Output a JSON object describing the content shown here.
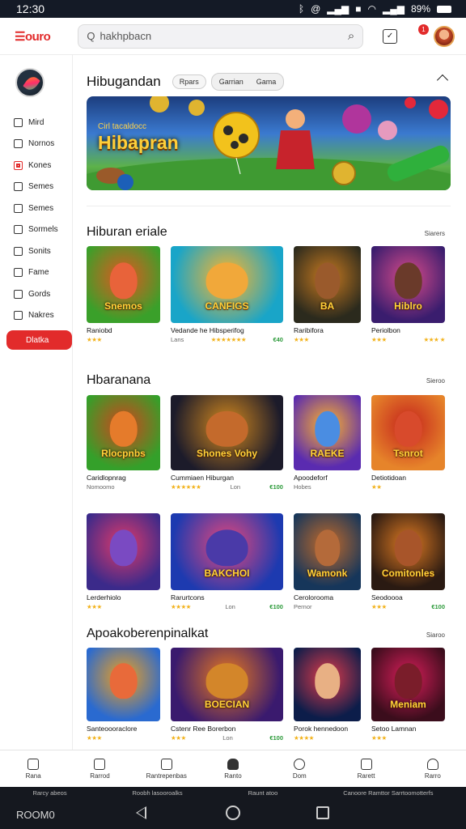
{
  "status": {
    "time": "12:30",
    "battery": "89%"
  },
  "topbar": {
    "logo": "☰ouro",
    "search_placeholder": "hakhpbacn",
    "badge": "1"
  },
  "sidebar": {
    "items": [
      {
        "label": "Mird"
      },
      {
        "label": "Nornos"
      },
      {
        "label": "Kones"
      },
      {
        "label": "Semes"
      },
      {
        "label": "Semes"
      },
      {
        "label": "Sormels"
      },
      {
        "label": "Sonits"
      },
      {
        "label": "Fame"
      },
      {
        "label": "Gords"
      },
      {
        "label": "Nakres"
      }
    ],
    "cta": "Dlatka"
  },
  "hero": {
    "title": "Hibugandan",
    "pills": [
      "Rpars",
      "Garrian",
      "Gama"
    ],
    "caption": "Cirl tacaldocc",
    "banner_text": "Hibapran"
  },
  "sections": [
    {
      "title": "Hiburan eriale",
      "more": "Siarers",
      "cards": [
        {
          "name": "Raniobd",
          "stars": "★★★",
          "meta": "",
          "price": "",
          "label": "Snemos",
          "c1": "#3aa02a",
          "c2": "#e2571f",
          "face": "#e8633a"
        },
        {
          "name": "Vedande he Hibsperifog",
          "stars": "★★★★★★★",
          "meta": "Lans",
          "price": "€40",
          "label": "CANFIGS",
          "c1": "#19a5c8",
          "c2": "#ffb52a",
          "face": "#f1a83a"
        },
        {
          "name": "Raribifora",
          "stars": "★★★",
          "meta": "",
          "price": "",
          "label": "BA",
          "c1": "#2b2a1d",
          "c2": "#c87a20",
          "face": "#9a5a2c"
        },
        {
          "name": "Periolbon",
          "stars": "★★★",
          "meta": "★★★ ★",
          "price": "",
          "label": "Hiblro",
          "c1": "#3a1d6e",
          "c2": "#d94b8a",
          "face": "#6a3a2a"
        }
      ]
    },
    {
      "title": "Hbaranana",
      "more": "Sieroo",
      "cards": [
        {
          "name": "Caridlopnrag",
          "stars": "Nomoomo",
          "meta": "",
          "price": "",
          "label": "Rlocpnbs",
          "c1": "#34a02a",
          "c2": "#d0441c",
          "face": "#e57b2b"
        },
        {
          "name": "Cummiaen Hiburgan",
          "stars": "★★★★★★",
          "meta": "Lon",
          "price": "€100",
          "label": "Shones Vohy",
          "c1": "#1c1b2a",
          "c2": "#d58a1e",
          "face": "#c46a2c"
        },
        {
          "name": "Apoodeforf",
          "stars": "Hobes",
          "meta": "",
          "price": "",
          "label": "RAEKE",
          "c1": "#5a2bb0",
          "c2": "#ffb42a",
          "face": "#4a8de2"
        },
        {
          "name": "Detiotidoan",
          "stars": "★★",
          "meta": "",
          "price": "",
          "label": "Tsnrot",
          "c1": "#e6842a",
          "c2": "#c4221c",
          "face": "#d84a2c"
        }
      ]
    },
    {
      "title": "",
      "more": "",
      "cards": [
        {
          "name": "Lerderhiolo",
          "stars": "★★★",
          "meta": "",
          "price": "",
          "label": "",
          "c1": "#3b2a8a",
          "c2": "#e03a6a",
          "face": "#7a4ac2"
        },
        {
          "name": "Rarurtcons",
          "stars": "★★★★",
          "meta": "Lon",
          "price": "€100",
          "label": "BAKCHOI",
          "c1": "#1d3ab0",
          "c2": "#e8477a",
          "face": "#4a3aa8"
        },
        {
          "name": "Cerolorooma",
          "stars": "Pernor",
          "meta": "",
          "price": "",
          "label": "Wamonk",
          "c1": "#16365a",
          "c2": "#c26a2a",
          "face": "#b46a3a"
        },
        {
          "name": "Seodoooa",
          "stars": "★★★",
          "meta": "",
          "price": "€100",
          "label": "Comitonles",
          "c1": "#2a1a12",
          "c2": "#e07b22",
          "face": "#a8552a"
        }
      ]
    },
    {
      "title": "Apoakoberenpinalkat",
      "more": "Siaroo",
      "cards": [
        {
          "name": "Santeoooraclore",
          "stars": "★★★",
          "meta": "",
          "price": "",
          "label": "",
          "c1": "#2a6ad0",
          "c2": "#f0a01c",
          "face": "#e86a3a"
        },
        {
          "name": "Cstenr Ree Borerbon",
          "stars": "★★★",
          "meta": "Lon",
          "price": "€100",
          "label": "BOECIAN",
          "c1": "#3a1a6e",
          "c2": "#ea7a1e",
          "face": "#d3862a"
        },
        {
          "name": "Porok hennedoon",
          "stars": "★★★★",
          "meta": "",
          "price": "",
          "label": "",
          "c1": "#0c1d4a",
          "c2": "#e03a4a",
          "face": "#e8b084"
        },
        {
          "name": "Setoo Lamnan",
          "stars": "★★★",
          "meta": "",
          "price": "",
          "label": "Meniam",
          "c1": "#3b0d1c",
          "c2": "#d91e5a",
          "face": "#7a1d2a"
        }
      ]
    }
  ],
  "bottomnav": [
    "Rana",
    "Rarrod",
    "Rantrepenbas",
    "Ranto",
    "Dom",
    "Rarett",
    "Rarro"
  ],
  "sysbar": {
    "row": [
      "Rarcy abeos",
      "Roobh lasooroalks",
      "Raunt atoo",
      "Canoore Ramttor Sarrtoomotterfs"
    ],
    "clock": "ROOM0"
  }
}
